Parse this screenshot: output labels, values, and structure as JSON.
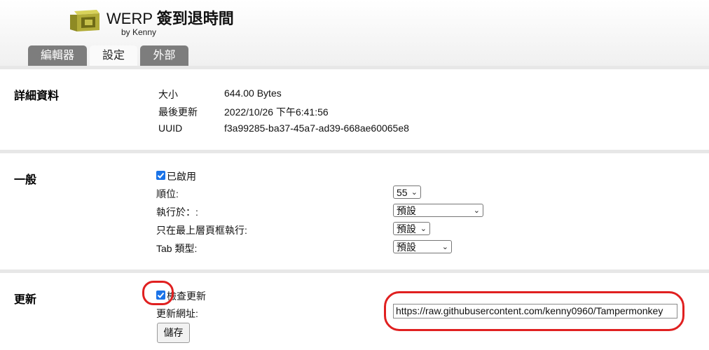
{
  "app": {
    "title_prefix": "WERP ",
    "title_cjk": "簽到退時間",
    "byline": "by Kenny"
  },
  "tabs": [
    {
      "label": "編輯器",
      "active": false
    },
    {
      "label": "設定",
      "active": true
    },
    {
      "label": "外部",
      "active": false
    }
  ],
  "details": {
    "title": "詳細資料",
    "size_label": "大小",
    "size_value": "644.00 Bytes",
    "updated_label": "最後更新",
    "updated_value": "2022/10/26 下午6:41:56",
    "uuid_label": "UUID",
    "uuid_value": "f3a99285-ba37-45a7-ad39-668ae60065e8"
  },
  "general": {
    "title": "一般",
    "enabled_label": "已啟用",
    "enabled_checked": true,
    "order_label": "順位:",
    "order_value": "55",
    "run_at_label": "執行於：:",
    "run_at_value": "預設",
    "top_frame_label": "只在最上層頁框執行:",
    "top_frame_value": "預設",
    "tab_type_label": "Tab 類型:",
    "tab_type_value": "預設"
  },
  "update": {
    "title": "更新",
    "check_label": "檢查更新",
    "check_checked": true,
    "url_label": "更新網址:",
    "url_value": "https://raw.githubusercontent.com/kenny0960/Tampermonkey",
    "save_label": "儲存"
  },
  "colors": {
    "checkbox_accent": "#1a73e8",
    "annotation_red": "#e02020",
    "tab_inactive": "#7d7d7d"
  }
}
